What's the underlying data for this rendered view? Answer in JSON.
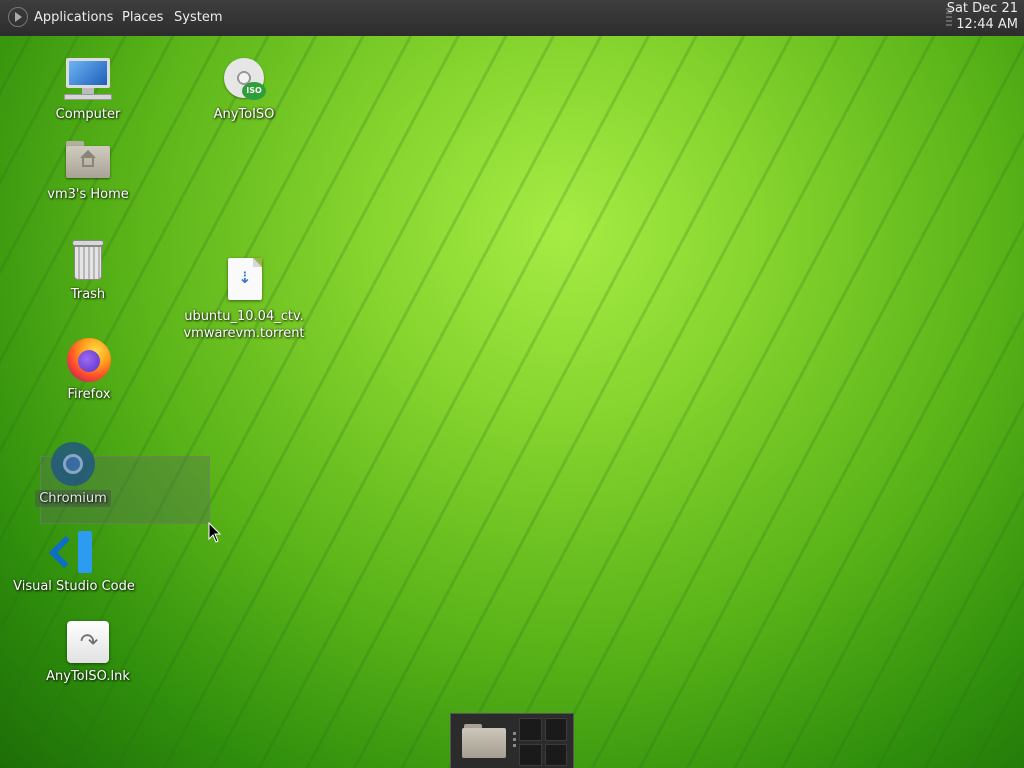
{
  "panel": {
    "menus": [
      {
        "label": "Applications"
      },
      {
        "label": "Places"
      },
      {
        "label": "System"
      }
    ],
    "clock": {
      "date": "Sat Dec 21",
      "time": "12:44 AM"
    }
  },
  "desktop": {
    "icons": {
      "computer": {
        "label": "Computer",
        "icon": "monitor-icon"
      },
      "home": {
        "label": "vm3's Home",
        "icon": "home-folder-icon"
      },
      "trash": {
        "label": "Trash",
        "icon": "trash-icon"
      },
      "firefox": {
        "label": "Firefox",
        "icon": "firefox-icon"
      },
      "chromium": {
        "label": "Chromium",
        "icon": "chromium-icon",
        "selected": true
      },
      "vscode": {
        "label": "Visual Studio Code",
        "icon": "vscode-icon"
      },
      "anytoiso_lnk": {
        "label": "AnyToISO.lnk",
        "icon": "shortcut-icon"
      },
      "anytoiso": {
        "label": "AnyToISO",
        "icon": "disc-iso-icon",
        "badge": "ISO"
      },
      "torrent": {
        "label_line1": "ubuntu_10.04_ctv.",
        "label_line2": "vmwarevm.torrent",
        "icon": "torrent-file-icon"
      }
    }
  },
  "dock": {
    "items": [
      "file-manager-icon",
      "workspace-switcher"
    ]
  },
  "colors": {
    "panel_bg": "#2d2d2d",
    "panel_text": "#ececec",
    "wallpaper_green": "#59b318"
  }
}
